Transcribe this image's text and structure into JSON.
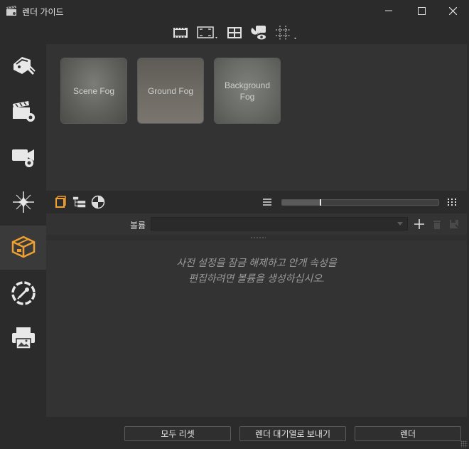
{
  "window": {
    "title": "렌더 가이드",
    "app_icon": "clapperboard-icon",
    "controls": [
      "minimize-icon",
      "maximize-icon",
      "close-icon"
    ]
  },
  "toolbar": {
    "items": [
      "film-frame-icon",
      "fit-frame-icon",
      "grid-layout-icon",
      "render-view-icon",
      "crosshair-grid-icon"
    ]
  },
  "sidebar": {
    "items": [
      {
        "icon": "render-settings-icon",
        "active": false
      },
      {
        "icon": "clapper-settings-icon",
        "active": false
      },
      {
        "icon": "camera-settings-icon",
        "active": false
      },
      {
        "icon": "light-icon",
        "active": false
      },
      {
        "icon": "volume-box-icon",
        "active": true
      },
      {
        "icon": "aperture-icon",
        "active": false
      },
      {
        "icon": "print-icon",
        "active": false
      }
    ]
  },
  "presets": [
    {
      "label": "Scene Fog"
    },
    {
      "label": "Ground Fog"
    },
    {
      "label": "Background Fog"
    }
  ],
  "volume_toolbar": {
    "icons": [
      "cube-orange-icon",
      "tree-list-icon",
      "pie-chart-icon"
    ],
    "menu_icon": "hamburger-icon",
    "grid_icon": "grid-dots-icon",
    "slider_value": 0.24
  },
  "volume_field": {
    "label": "볼륨",
    "value": "",
    "add_icon": "plus-icon",
    "delete_icon": "trash-icon",
    "extra_icon": "save-disabled-icon"
  },
  "message": {
    "line1": "사전 설정을 잠금 해제하고 안개 속성을",
    "line2": "편집하려면 볼륨을 생성하십시오."
  },
  "buttons": {
    "reset_all": "모두 리셋",
    "send_to_queue": "렌더 대기열로 보내기",
    "render": "렌더"
  },
  "colors": {
    "accent": "#f0a030",
    "background": "#2b2b2b",
    "panel": "#333333"
  }
}
